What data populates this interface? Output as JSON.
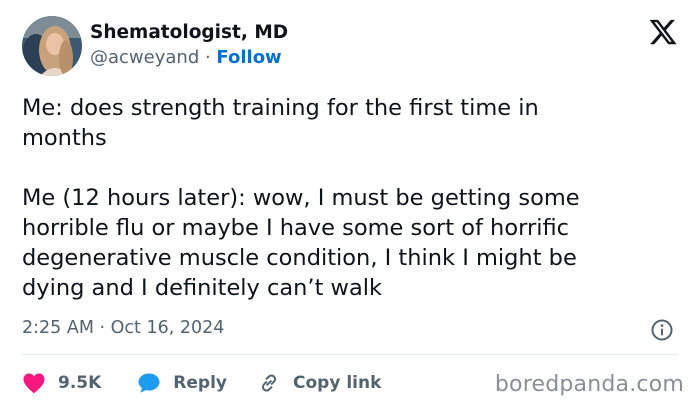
{
  "author": {
    "display_name": "Shematologist, MD",
    "handle": "@acweyand",
    "separator": " · ",
    "follow_label": "Follow"
  },
  "tweet": {
    "text": "Me: does strength training for the first time in\nmonths\n\nMe (12 hours later): wow, I must be getting some\nhorrible flu or maybe I have some sort of horrific\ndegenerative muscle condition, I think I might be\ndying and I definitely can’t walk",
    "timestamp": "2:25 AM · Oct 16, 2024"
  },
  "actions": {
    "like_count": "9.5K",
    "reply_label": "Reply",
    "copy_link_label": "Copy link"
  },
  "icons": {
    "logo": "x-logo-icon",
    "info": "info-icon",
    "like": "heart-icon",
    "reply": "speech-bubble-icon",
    "copy_link": "link-icon"
  },
  "colors": {
    "like": "#f91880",
    "reply": "#1d9bf0",
    "copy_link": "#536471",
    "follow": "#006fd6",
    "secondary_text": "#536471"
  },
  "watermark": "boredpanda.com"
}
